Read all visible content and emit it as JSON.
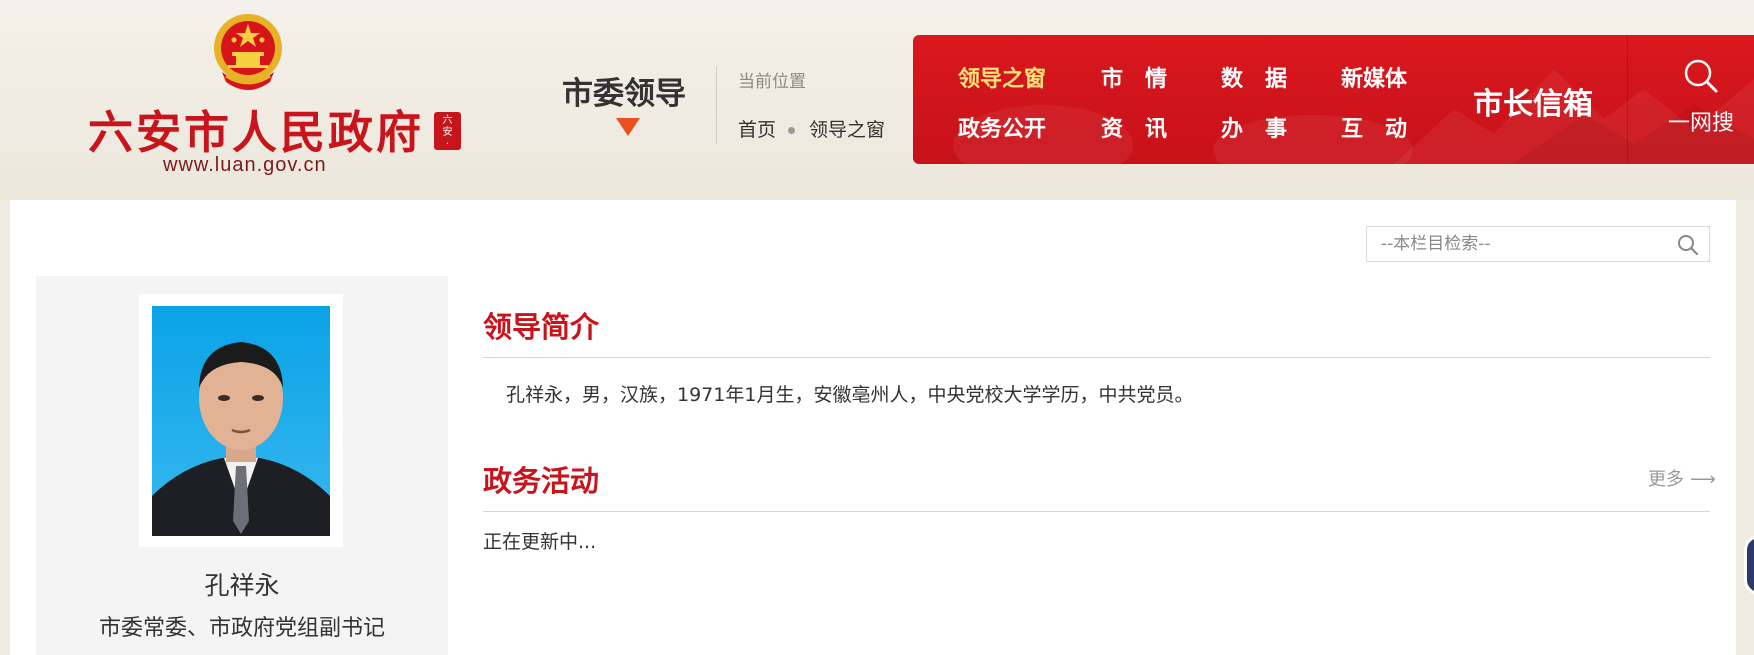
{
  "site": {
    "name": "六安市人民政府",
    "url": "www.luan.gov.cn",
    "emblem_icon": "national-emblem",
    "seal_text": "六安",
    "brand_color": "#c8141b"
  },
  "section": {
    "title": "市委领导"
  },
  "breadcrumb": {
    "label": "当前位置",
    "items": [
      "首页",
      "领导之窗"
    ]
  },
  "nav": {
    "items": [
      {
        "label": "领导之窗",
        "active": true
      },
      {
        "label": "市　情"
      },
      {
        "label": "数　据"
      },
      {
        "label": "新媒体"
      },
      {
        "label": "政务公开"
      },
      {
        "label": "资　讯"
      },
      {
        "label": "办　事"
      },
      {
        "label": "互　动"
      }
    ],
    "mailbox": "市长信箱",
    "search_label": "一网搜",
    "search_icon": "search-icon",
    "active_color": "#ffe27a"
  },
  "column_search": {
    "placeholder": "--本栏目检索--",
    "icon": "search-icon"
  },
  "leader": {
    "name": "孔祥永",
    "position": "市委常委、市政府党组副书记"
  },
  "intro": {
    "title": "领导简介",
    "text": "孔祥永，男，汉族，1971年1月生，安徽亳州人，中央党校大学学历，中共党员。"
  },
  "activities": {
    "title": "政务活动",
    "more": "更多",
    "status": "正在更新中..."
  }
}
